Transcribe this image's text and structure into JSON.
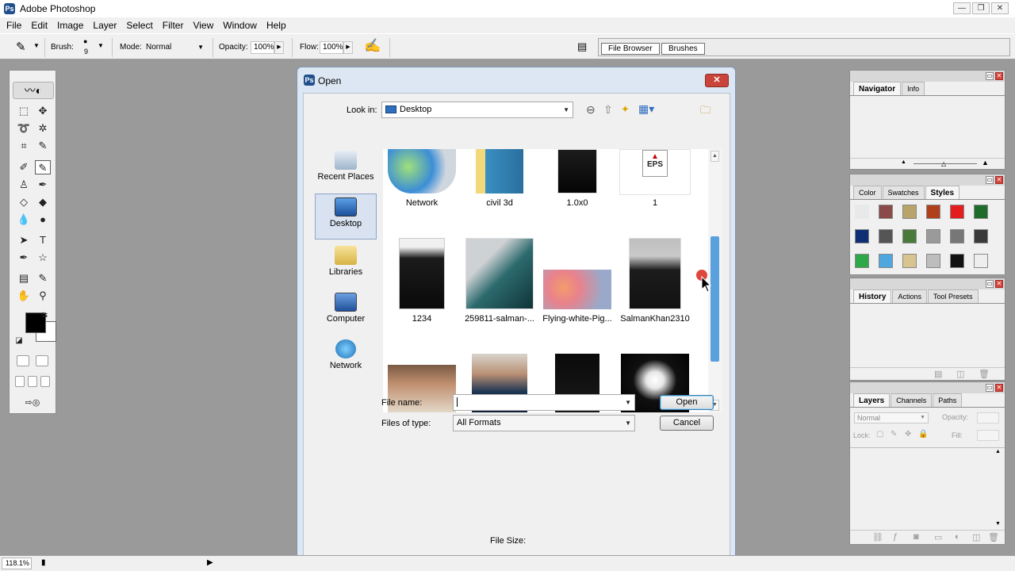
{
  "app": {
    "title": "Adobe Photoshop"
  },
  "menu": [
    "File",
    "Edit",
    "Image",
    "Layer",
    "Select",
    "Filter",
    "View",
    "Window",
    "Help"
  ],
  "options": {
    "brush_label": "Brush:",
    "brush_size": "9",
    "mode_label": "Mode:",
    "mode_value": "Normal",
    "opacity_label": "Opacity:",
    "opacity_value": "100%",
    "flow_label": "Flow:",
    "flow_value": "100%"
  },
  "palette_well": {
    "tab1": "File Browser",
    "tab2": "Brushes"
  },
  "panels": {
    "navigator": {
      "tabs": [
        "Navigator",
        "Info"
      ]
    },
    "styles": {
      "tabs": [
        "Color",
        "Swatches",
        "Styles"
      ]
    },
    "history": {
      "tabs": [
        "History",
        "Actions",
        "Tool Presets"
      ]
    },
    "layers": {
      "tabs": [
        "Layers",
        "Channels",
        "Paths"
      ],
      "mode": "Normal",
      "opacity_label": "Opacity:",
      "lock_label": "Lock:",
      "fill_label": "Fill:"
    }
  },
  "dialog": {
    "title": "Open",
    "look_in_label": "Look in:",
    "look_in_value": "Desktop",
    "places": [
      "Recent Places",
      "Desktop",
      "Libraries",
      "Computer",
      "Network"
    ],
    "files": [
      "Network",
      "civil 3d",
      "1.0x0",
      "1",
      "1234",
      "259811-salman-...",
      "Flying-white-Pig...",
      "SalmanKhan2310",
      "",
      "",
      "",
      ""
    ],
    "file_name_label": "File name:",
    "file_name_value": "",
    "files_of_type_label": "Files of type:",
    "files_of_type_value": "All Formats",
    "open_button": "Open",
    "cancel_button": "Cancel",
    "file_size_label": "File Size:"
  },
  "status": {
    "zoom": "118.1%"
  },
  "colors": {
    "selection_blue": "#d8e2f0",
    "scroll_thumb": "#5aa0dc",
    "close_red": "#c9453b"
  }
}
